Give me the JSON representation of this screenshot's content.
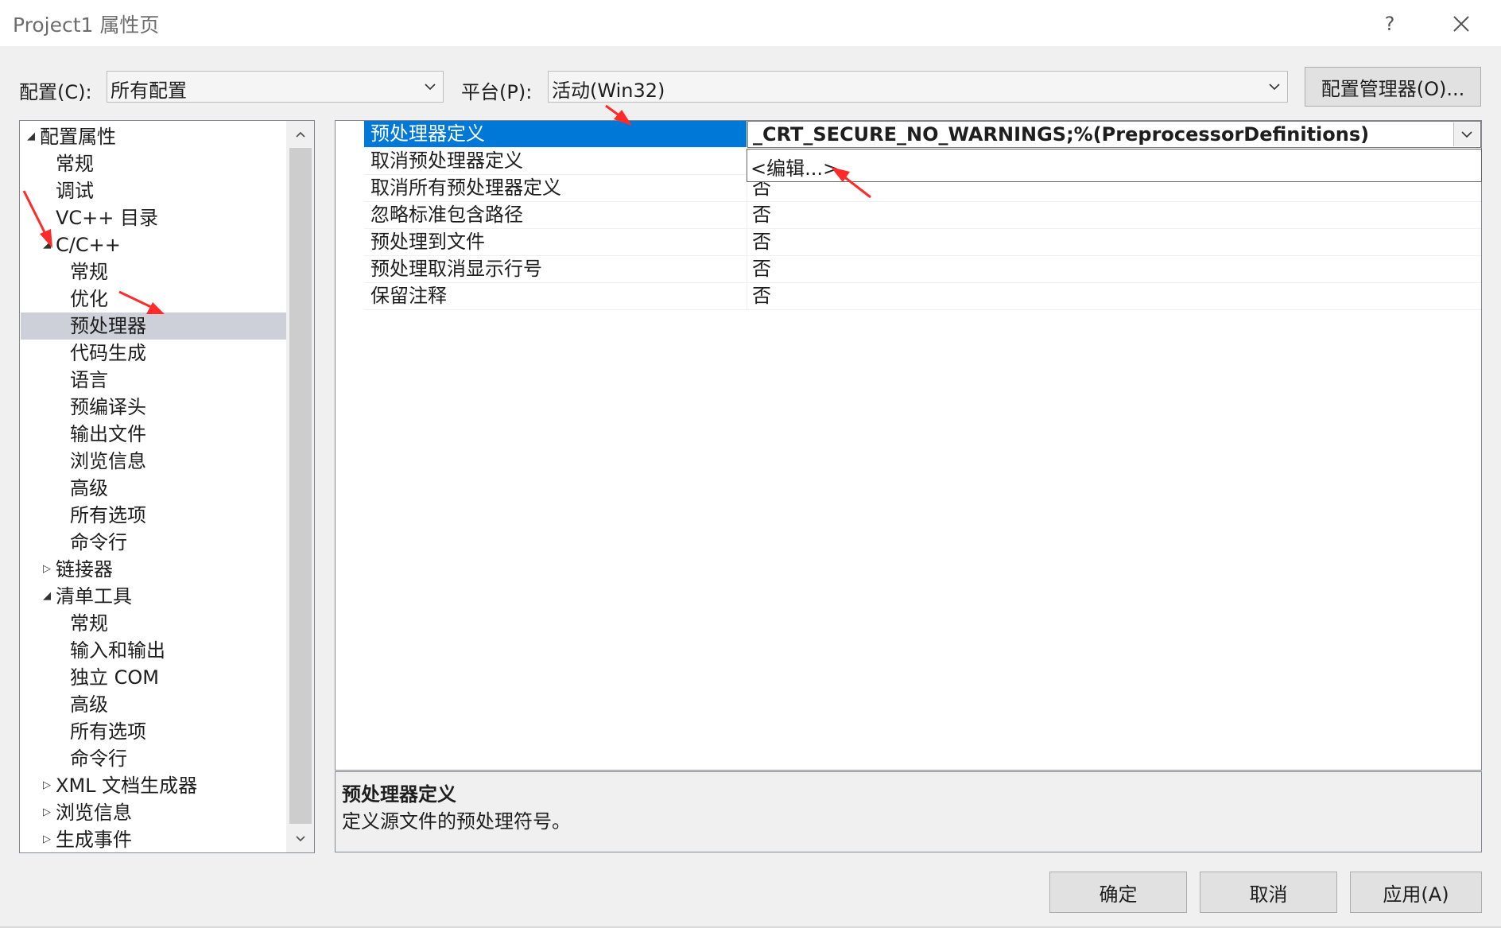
{
  "window": {
    "title": "Project1 属性页",
    "help_label": "?",
    "close_label": "✕"
  },
  "config": {
    "label": "配置(C):",
    "value": "所有配置",
    "platform_label": "平台(P):",
    "platform_value": "活动(Win32)",
    "manager_button": "配置管理器(O)..."
  },
  "tree": {
    "items": [
      {
        "label": "配置属性",
        "toggle": "◢"
      },
      {
        "label": "常规"
      },
      {
        "label": "调试"
      },
      {
        "label": "VC++ 目录"
      },
      {
        "label": "C/C++",
        "toggle": "◢"
      },
      {
        "label": "常规"
      },
      {
        "label": "优化"
      },
      {
        "label": "预处理器",
        "selected": true
      },
      {
        "label": "代码生成"
      },
      {
        "label": "语言"
      },
      {
        "label": "预编译头"
      },
      {
        "label": "输出文件"
      },
      {
        "label": "浏览信息"
      },
      {
        "label": "高级"
      },
      {
        "label": "所有选项"
      },
      {
        "label": "命令行"
      },
      {
        "label": "链接器",
        "toggle": "▷"
      },
      {
        "label": "清单工具",
        "toggle": "◢"
      },
      {
        "label": "常规"
      },
      {
        "label": "输入和输出"
      },
      {
        "label": "独立 COM"
      },
      {
        "label": "高级"
      },
      {
        "label": "所有选项"
      },
      {
        "label": "命令行"
      },
      {
        "label": "XML 文档生成器",
        "toggle": "▷"
      },
      {
        "label": "浏览信息",
        "toggle": "▷"
      },
      {
        "label": "生成事件",
        "toggle": "▷"
      }
    ]
  },
  "properties": [
    {
      "name": "预处理器定义",
      "value": "_CRT_SECURE_NO_WARNINGS;%(PreprocessorDefinitions)"
    },
    {
      "name": "取消预处理器定义",
      "value": ""
    },
    {
      "name": "取消所有预处理器定义",
      "value": "否"
    },
    {
      "name": "忽略标准包含路径",
      "value": "否"
    },
    {
      "name": "预处理到文件",
      "value": "否"
    },
    {
      "name": "预处理取消显示行号",
      "value": "否"
    },
    {
      "name": "保留注释",
      "value": "否"
    }
  ],
  "dropdown": {
    "option": "<编辑...>"
  },
  "description": {
    "title": "预处理器定义",
    "text": "定义源文件的预处理符号。"
  },
  "buttons": {
    "ok": "确定",
    "cancel": "取消",
    "apply": "应用(A)"
  },
  "colors": {
    "selection": "#0078d7",
    "tree_selection": "#cdd0d9",
    "annotation": "#ff2a2a"
  }
}
